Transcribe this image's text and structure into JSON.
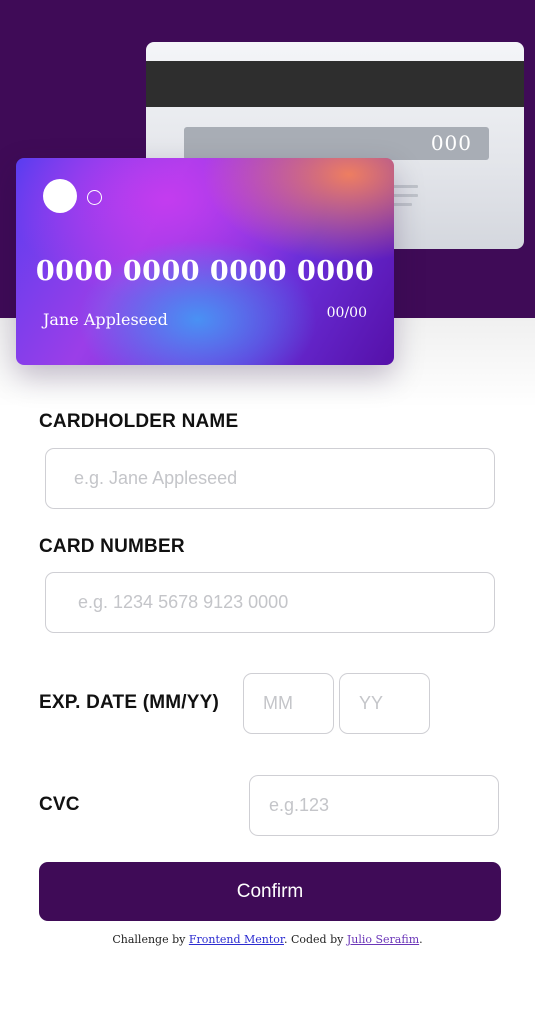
{
  "card_preview": {
    "number": "0000 0000 0000 0000",
    "holder_name": "Jane Appleseed",
    "expiry": "00/00",
    "cvc": "000"
  },
  "form": {
    "cardholder_name": {
      "label": "CARDHOLDER NAME",
      "placeholder": "e.g. Jane Appleseed",
      "value": ""
    },
    "card_number": {
      "label": "CARD NUMBER",
      "placeholder": "e.g. 1234 5678 9123 0000",
      "value": ""
    },
    "exp_date": {
      "label": "EXP. DATE (MM/YY)",
      "month_placeholder": "MM",
      "year_placeholder": "YY"
    },
    "cvc": {
      "label": "CVC",
      "placeholder": "e.g.123",
      "value": ""
    },
    "confirm_label": "Confirm"
  },
  "attribution": {
    "prefix": "Challenge by ",
    "link1": "Frontend Mentor",
    "middle": ". Coded by ",
    "link2": "Julio Serafim",
    "suffix": "."
  },
  "colors": {
    "brand": "#3f0b57",
    "input_border": "#cfcfd4",
    "placeholder": "#c4c5c9"
  }
}
